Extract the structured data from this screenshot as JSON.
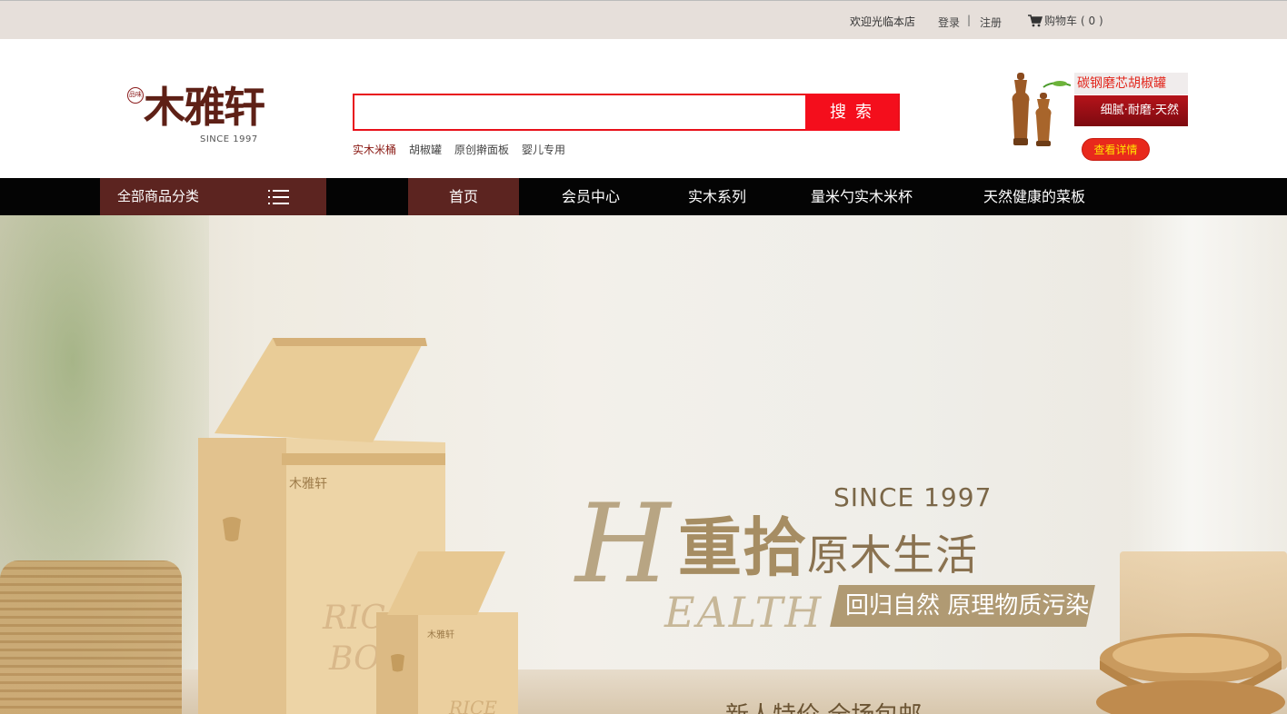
{
  "topbar": {
    "welcome": "欢迎光临本店",
    "login": "登录",
    "separator": "|",
    "register": "注册",
    "cart_label": "购物车",
    "cart_count": "( 0 )"
  },
  "logo": {
    "seal_text": "品味",
    "name": "木雅轩",
    "since": "SINCE 1997"
  },
  "search": {
    "value": "",
    "placeholder": "",
    "button_label": "搜索",
    "hot_words": [
      "实木米桶",
      "胡椒罐",
      "原创擀面板",
      "婴儿专用"
    ]
  },
  "promo": {
    "title": "碳钢磨芯胡椒罐",
    "subtitle": "细腻·耐磨·天然",
    "detail_button": "查看详情"
  },
  "nav": {
    "all_categories": "全部商品分类",
    "items": [
      "首页",
      "会员中心",
      "实木系列",
      "量米勺实木米杯",
      "天然健康的菜板"
    ],
    "active_index": 0
  },
  "banner": {
    "since": "SINCE 1997",
    "big_letter": "H",
    "headline_big": "重拾",
    "headline_rest": "原木生活",
    "ealth": "EALTH",
    "tagline": "回归自然 原理物质污染",
    "bottom_text": "新人特价 全场包邮"
  },
  "colors": {
    "accent_red": "#f40e1c",
    "nav_brown": "#5c2420",
    "nav_black": "#040404",
    "topbar_bg": "#e6dfda"
  }
}
